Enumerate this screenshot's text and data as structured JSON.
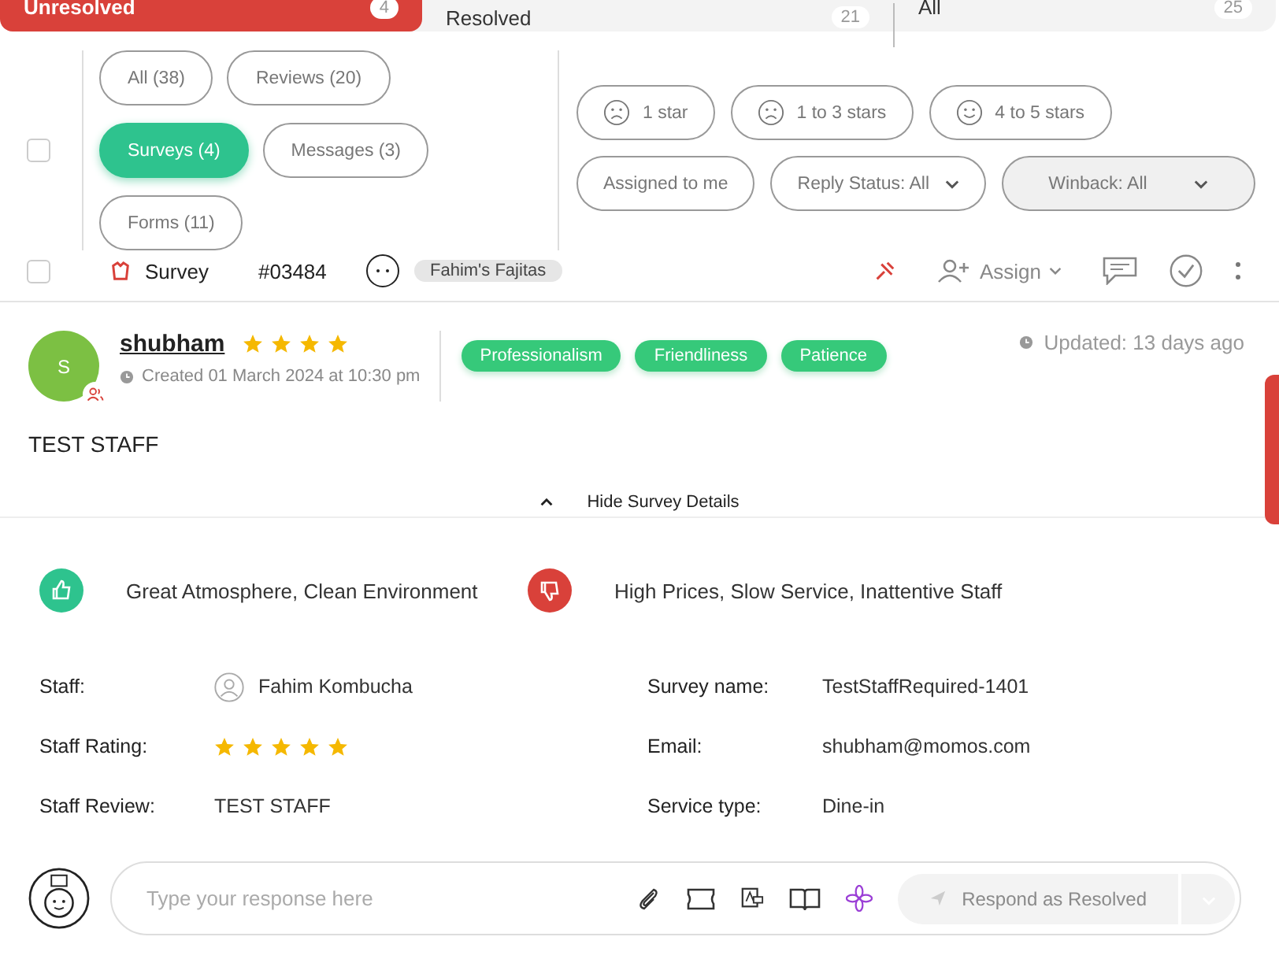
{
  "tabs": [
    {
      "label": "Unresolved",
      "count": "4",
      "selected": true
    },
    {
      "label": "Resolved",
      "count": "21",
      "selected": false
    },
    {
      "label": "All",
      "count": "25",
      "selected": false
    }
  ],
  "select_all": {
    "checked": false
  },
  "type_filters": [
    {
      "label": "All (38)",
      "selected": false
    },
    {
      "label": "Reviews (20)",
      "selected": false
    },
    {
      "label": "Surveys (4)",
      "selected": true
    },
    {
      "label": "Messages (3)",
      "selected": false
    },
    {
      "label": "Forms (11)",
      "selected": false
    }
  ],
  "rating_filters": [
    {
      "label": "1 star",
      "kind": "sad"
    },
    {
      "label": "1 to 3 stars",
      "kind": "sad"
    },
    {
      "label": "4 to 5 stars",
      "kind": "happy"
    }
  ],
  "other_filters": [
    {
      "label": "Assigned to me",
      "kind": "toggle"
    },
    {
      "label": "Reply Status: All",
      "kind": "dropdown"
    },
    {
      "label": "Winback: All",
      "kind": "select"
    }
  ],
  "list_row": {
    "checked": false,
    "type": "Survey",
    "id": "#03484",
    "location": "Fahim's Fajitas",
    "assign": "Assign"
  },
  "review": {
    "initial": "S",
    "name": "shubham",
    "stars": 4,
    "created": "Created 01 March 2024 at 10:30 pm",
    "tags": [
      "Professionalism",
      "Friendliness",
      "Patience"
    ],
    "updated": "Updated: 13 days ago",
    "text": "TEST STAFF",
    "toggle": "Hide Survey Details"
  },
  "feedback": [
    {
      "kind": "positive",
      "text": "Great Atmosphere, Clean Environment"
    },
    {
      "kind": "negative",
      "text": "High Prices, Slow Service, Inattentive Staff"
    }
  ],
  "details_left": [
    {
      "label": "Staff:",
      "kind": "person",
      "value": "Fahim Kombucha"
    },
    {
      "label": "Staff Rating:",
      "kind": "stars",
      "stars": 5
    },
    {
      "label": "Staff Review:",
      "kind": "text",
      "value": "TEST STAFF"
    }
  ],
  "details_right": [
    {
      "label": "Survey name:",
      "value": "TestStaffRequired-1401"
    },
    {
      "label": "Email:",
      "value": "shubham@momos.com"
    },
    {
      "label": "Service type:",
      "value": "Dine-in"
    }
  ],
  "composer": {
    "placeholder": "Type your response here",
    "button": "Respond as Resolved",
    "disabled": true
  }
}
